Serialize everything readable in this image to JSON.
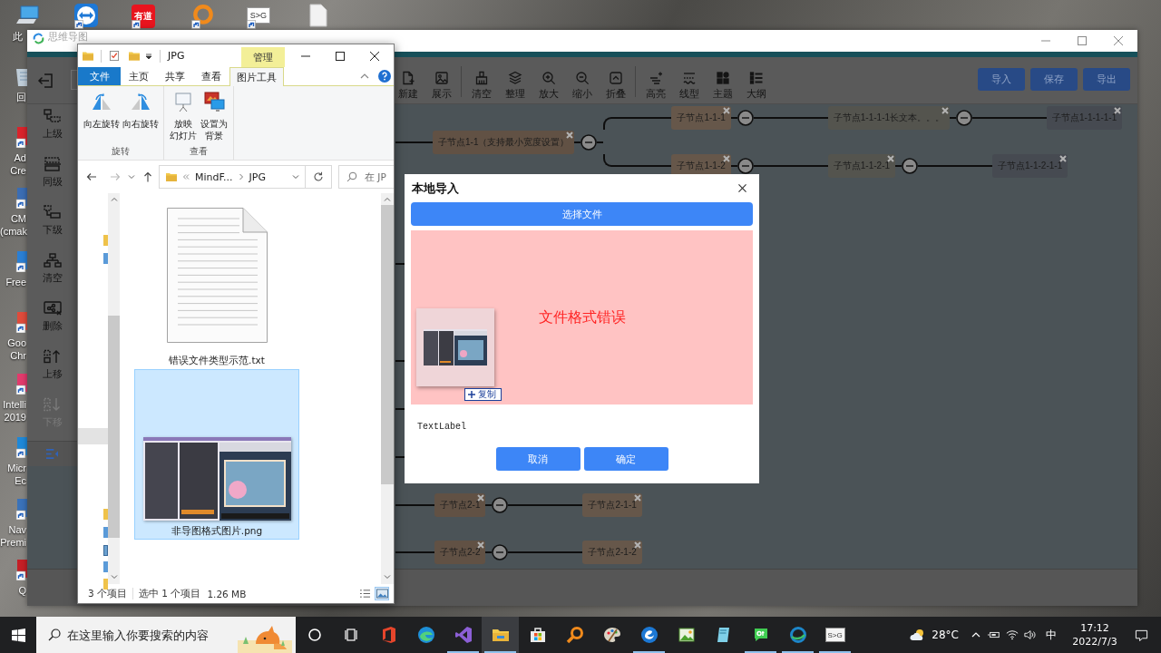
{
  "desktop": {
    "top_icons": [
      {
        "kind": "monitor",
        "label": "此"
      },
      {
        "kind": "arrows"
      },
      {
        "kind": "logo",
        "text": "有道"
      },
      {
        "kind": "ring"
      },
      {
        "kind": "sign",
        "text": "S>G"
      },
      {
        "kind": "page"
      }
    ],
    "left_icons": [
      {
        "label_lines": [
          "回"
        ]
      },
      {
        "label_lines": [
          "Ad",
          "Cre"
        ]
      },
      {
        "label_lines": [
          "CM",
          "(cmak"
        ]
      },
      {
        "label_lines": [
          "Free"
        ]
      },
      {
        "label_lines": [
          "Goo",
          "Chr"
        ]
      },
      {
        "label_lines": [
          "Intelli",
          "2019"
        ]
      },
      {
        "label_lines": [
          "Micr",
          "Ec"
        ]
      },
      {
        "label_lines": [
          "Nav",
          "Premi"
        ]
      },
      {
        "label_lines": [
          "Q"
        ]
      }
    ]
  },
  "mindmap": {
    "title": "思维导图",
    "toolbar": {
      "tool_groups": [
        [
          "新建",
          "展示"
        ],
        [
          "清空",
          "整理",
          "放大",
          "缩小",
          "折叠"
        ],
        [
          "高亮",
          "线型",
          "主题",
          "大纲"
        ]
      ],
      "actions": [
        "导入",
        "保存",
        "导出"
      ]
    },
    "sidebar": [
      {
        "label": "上级",
        "disabled": false
      },
      {
        "label": "同级",
        "disabled": false
      },
      {
        "label": "下级",
        "disabled": false
      },
      {
        "label": "清空",
        "disabled": false
      },
      {
        "label": "删除",
        "disabled": false
      },
      {
        "label": "上移",
        "disabled": false
      },
      {
        "label": "下移",
        "disabled": true
      }
    ],
    "nodes": [
      {
        "label": "子节点1-1（支持最小宽度设置）",
        "expanded": true,
        "children": [
          {
            "label": "子节点1-1-1",
            "expanded": true,
            "children": [
              {
                "label": "子节点1-1-1-1长文本。。。",
                "expanded": true,
                "children": [
                  {
                    "label": "子节点1-1-1-1-1"
                  }
                ]
              }
            ]
          },
          {
            "label": "子节点1-1-2",
            "expanded": true,
            "children": [
              {
                "label": "子节点1-1-2-1",
                "expanded": true,
                "children": [
                  {
                    "label": "子节点1-1-2-1-1"
                  }
                ]
              }
            ]
          }
        ]
      },
      {
        "label": "子节点2-1",
        "expanded": true,
        "children": [
          {
            "label": "子节点2-1-1"
          }
        ]
      },
      {
        "label": "子节点2-2",
        "expanded": true,
        "children": [
          {
            "label": "子节点2-1-2"
          }
        ]
      }
    ],
    "dialog": {
      "title": "本地导入",
      "choose_button": "选择文件",
      "error": "文件格式错误",
      "drag_badge": "复制",
      "text_label": "TextLabel",
      "buttons": [
        "取消",
        "确定"
      ]
    }
  },
  "explorer": {
    "title": "JPG",
    "context_tab": "管理",
    "tabs": [
      {
        "label": "文件",
        "kind": "menu",
        "selected": false
      },
      {
        "label": "主页",
        "kind": "tab",
        "selected": false
      },
      {
        "label": "共享",
        "kind": "tab",
        "selected": false
      },
      {
        "label": "查看",
        "kind": "tab",
        "selected": false
      },
      {
        "label": "图片工具",
        "kind": "tab",
        "selected": true
      }
    ],
    "ribbon_groups": [
      {
        "label": "旋转",
        "commands": [
          {
            "lines": [
              "向左旋转"
            ]
          },
          {
            "lines": [
              "向右旋转"
            ]
          }
        ]
      },
      {
        "label": "查看",
        "commands": [
          {
            "lines": [
              "放映",
              "幻灯片"
            ]
          },
          {
            "lines": [
              "设置为",
              "背景"
            ]
          }
        ]
      }
    ],
    "breadcrumb": [
      "MindF...",
      "JPG"
    ],
    "search_placeholder": "在 JP",
    "files": [
      {
        "name": "错误文件类型示范.txt",
        "kind": "text",
        "selected": false
      },
      {
        "name": "非导图格式图片.png",
        "kind": "image",
        "selected": true
      }
    ],
    "status": {
      "count": "3 个项目",
      "selection": "选中 1 个项目",
      "size": "1.26 MB",
      "views": [
        {
          "selected": false
        },
        {
          "selected": true
        }
      ]
    }
  },
  "taskbar": {
    "search_placeholder": "在这里输入你要搜索的内容",
    "apps": [
      {
        "kind": "office",
        "running": false,
        "selected": false
      },
      {
        "kind": "browser",
        "running": false,
        "selected": false
      },
      {
        "kind": "studio",
        "running": true,
        "selected": false
      },
      {
        "kind": "folder",
        "running": true,
        "selected": true
      },
      {
        "kind": "store",
        "running": false,
        "selected": false
      },
      {
        "kind": "magnifier",
        "running": false,
        "selected": false
      },
      {
        "kind": "palette",
        "running": false,
        "selected": false
      },
      {
        "kind": "swirl",
        "running": true,
        "selected": false
      },
      {
        "kind": "picture",
        "running": false,
        "selected": false
      },
      {
        "kind": "book",
        "running": false,
        "selected": false
      },
      {
        "kind": "bubble",
        "running": true,
        "selected": false
      },
      {
        "kind": "globe",
        "running": true,
        "selected": false
      },
      {
        "kind": "sign",
        "text": "S>G",
        "running": true,
        "selected": false
      }
    ],
    "weather": "28°C",
    "ime": "中",
    "time": "17:12",
    "date": "2022/7/3"
  }
}
